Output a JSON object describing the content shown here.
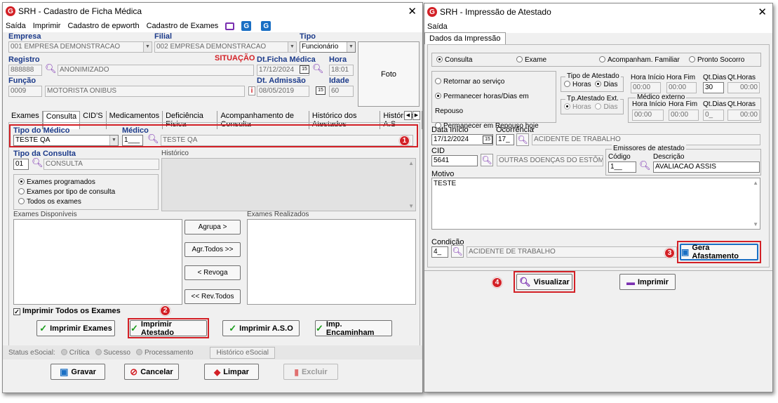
{
  "left": {
    "title": "SRH - Cadastro de Ficha Médica",
    "menu": [
      "Saída",
      "Imprimir",
      "Cadastro de epworth",
      "Cadastro de Exames"
    ],
    "empresa_lbl": "Empresa",
    "empresa": "001 EMPRESA DEMONSTRACAO",
    "filial_lbl": "Filial",
    "filial": "002 EMPRESA DEMONSTRACAO",
    "tipo_lbl": "Tipo",
    "tipo": "Funcionário",
    "registro_lbl": "Registro",
    "registro": "888888",
    "registro_nome": "ANONIMIZADO",
    "situacao": "SITUAÇÃO",
    "dtficha_lbl": "Dt.Ficha Médica",
    "dtficha": "17/12/2024",
    "hora_lbl": "Hora",
    "hora": "18:01",
    "funcao_lbl": "Função",
    "funcao": "0009",
    "funcao_nome": "MOTORISTA ONIBUS",
    "admissao_lbl": "Dt. Admissão",
    "admissao": "08/05/2019",
    "idade_lbl": "Idade",
    "idade": "60",
    "foto": "Foto",
    "tabs": [
      "Exames",
      "Consulta",
      "CID'S",
      "Medicamentos",
      "Deficiência Física",
      "Acompanhamento de Consulta",
      "Histórico dos Atestados",
      "Histórico A.S"
    ],
    "tipo_medico_lbl": "Tipo do Médico",
    "tipo_medico": "TESTE QA",
    "medico_lbl": "Médico",
    "medico_cod": "1___",
    "medico_nome": "TESTE QA",
    "tipo_consulta_lbl": "Tipo da Consulta",
    "tipo_consulta_cod": "01",
    "tipo_consulta": "CONSULTA",
    "historico_lbl": "Histórico",
    "radios": [
      "Exames programados",
      "Exames por tipo de consulta",
      "Todos os exames"
    ],
    "disp_lbl": "Exames Disponíveis",
    "real_lbl": "Exames Realizados",
    "move_btns": [
      "Agrupa >",
      "Agr.Todos >>",
      "< Revoga",
      "<< Rev.Todos"
    ],
    "imprimir_todos": "Imprimir Todos os Exames",
    "print_btns": [
      "Imprimir Exames",
      "Imprimir Atestado",
      "Imprimir A.S.O",
      "Imp. Encaminham"
    ],
    "status_lbl": "Status eSocial:",
    "status_items": [
      "Crítica",
      "Sucesso",
      "Processamento"
    ],
    "hist_esocial": "Histórico eSocial",
    "bottom_btns": [
      "Gravar",
      "Cancelar",
      "Limpar",
      "Excluir"
    ]
  },
  "right": {
    "title": "SRH - Impressão de Atestado",
    "menu": "Saída",
    "tab": "Dados da Impressão",
    "top_radios": [
      "Consulta",
      "Exame",
      "Acompanham. Familiar",
      "Pronto Socorro"
    ],
    "left_radios": [
      "Retornar ao serviço",
      "Permanecer  horas/Dias em Repouso",
      "Permanecer em Repouso hoje"
    ],
    "tipo_atestado": "Tipo de Atestado",
    "horas": "Horas",
    "dias": "Dias",
    "tp_ext": "Tp.Atestado Ext.",
    "medico_ext": "Médico externo",
    "hora_inicio": "Hora Início",
    "hora_fim": "Hora Fim",
    "qt_dias": "Qt.Dias",
    "qt_horas": "Qt.Horas",
    "hi1": "00:00",
    "hf1": "00:00",
    "qd1": "30",
    "qh1": "00:00",
    "hi2": "00:00",
    "hf2": "00:00",
    "qd2": "0_",
    "qh2": "00:00",
    "data_inicio_lbl": "Data Início",
    "data_inicio": "17/12/2024",
    "ocorrencia_lbl": "Ocorrência",
    "ocorrencia_cod": "17_",
    "ocorrencia": "ACIDENTE DE TRABALHO",
    "cid_lbl": "CID",
    "cid": "5641",
    "cid_desc": "OUTRAS DOENÇAS DO ESTÔMAG",
    "emissores": "Emissores de atestado",
    "codigo_lbl": "Código",
    "codigo": "1__",
    "descricao_lbl": "Descrição",
    "descricao": "AVALIACAO ASSIS",
    "motivo_lbl": "Motivo",
    "motivo": "TESTE",
    "condicao_lbl": "Condição",
    "condicao_cod": "4_",
    "condicao": "ACIDENTE DE TRABALHO",
    "gera": "Gera Afastamento",
    "visualizar": "Visualizar",
    "imprimir": "Imprimir"
  },
  "markers": [
    "1",
    "2",
    "3",
    "4"
  ],
  "colors": {
    "accent": "#d32026",
    "label_blue": "#1b3a8a",
    "check_green": "#1c9c1c"
  }
}
